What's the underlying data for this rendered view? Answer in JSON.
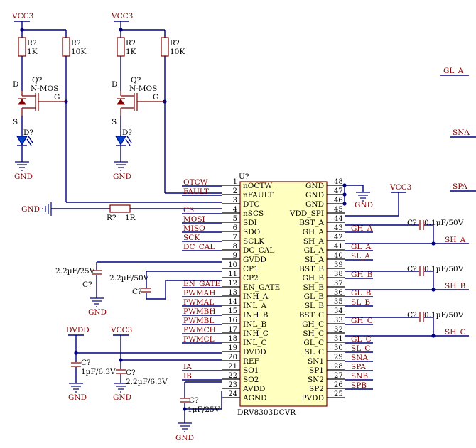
{
  "chip": {
    "designator": "U?",
    "part": "DRV8303DCVR",
    "left_pins": [
      {
        "num": "1",
        "name": "nOCTW",
        "net": "OTCW"
      },
      {
        "num": "2",
        "name": "nFAULT",
        "net": "FAULT"
      },
      {
        "num": "3",
        "name": "DTC",
        "net": ""
      },
      {
        "num": "4",
        "name": "nSCS",
        "net": "CS"
      },
      {
        "num": "5",
        "name": "SDI",
        "net": "MOSI"
      },
      {
        "num": "6",
        "name": "SDO",
        "net": "MISO"
      },
      {
        "num": "7",
        "name": "SCLK",
        "net": "SCK"
      },
      {
        "num": "8",
        "name": "DC_CAL",
        "net": "DC_CAL"
      },
      {
        "num": "9",
        "name": "GVDD",
        "net": ""
      },
      {
        "num": "10",
        "name": "CP1",
        "net": ""
      },
      {
        "num": "11",
        "name": "CP2",
        "net": ""
      },
      {
        "num": "12",
        "name": "EN_GATE",
        "net": "EN_GATE"
      },
      {
        "num": "13",
        "name": "INH_A",
        "net": "PWMAH"
      },
      {
        "num": "14",
        "name": "INL_A",
        "net": "PWMAL"
      },
      {
        "num": "15",
        "name": "INH_B",
        "net": "PWMBH"
      },
      {
        "num": "16",
        "name": "INL_B",
        "net": "PWMBL"
      },
      {
        "num": "17",
        "name": "INH_C",
        "net": "PWMCH"
      },
      {
        "num": "18",
        "name": "INL_C",
        "net": "PWMCL"
      },
      {
        "num": "19",
        "name": "DVDD",
        "net": ""
      },
      {
        "num": "20",
        "name": "REF",
        "net": ""
      },
      {
        "num": "21",
        "name": "SO1",
        "net": "IA"
      },
      {
        "num": "22",
        "name": "SO2",
        "net": "IB"
      },
      {
        "num": "23",
        "name": "AVDD",
        "net": ""
      },
      {
        "num": "24",
        "name": "AGND",
        "net": ""
      }
    ],
    "right_pins": [
      {
        "num": "48",
        "name": "GND",
        "net": ""
      },
      {
        "num": "47",
        "name": "GND",
        "net": ""
      },
      {
        "num": "46",
        "name": "GND",
        "net": ""
      },
      {
        "num": "45",
        "name": "VDD_SPI",
        "net": ""
      },
      {
        "num": "44",
        "name": "BST_A",
        "net": ""
      },
      {
        "num": "43",
        "name": "GH_A",
        "net": "GH_A"
      },
      {
        "num": "42",
        "name": "SH_A",
        "net": ""
      },
      {
        "num": "41",
        "name": "GL_A",
        "net": "GL_A"
      },
      {
        "num": "40",
        "name": "SL_A",
        "net": "SL_A"
      },
      {
        "num": "39",
        "name": "BST_B",
        "net": ""
      },
      {
        "num": "38",
        "name": "GH_B",
        "net": "GH_B"
      },
      {
        "num": "37",
        "name": "SH_B",
        "net": ""
      },
      {
        "num": "36",
        "name": "GL_B",
        "net": "GL_B"
      },
      {
        "num": "35",
        "name": "SL_B",
        "net": "SL_B"
      },
      {
        "num": "34",
        "name": "BST_C",
        "net": ""
      },
      {
        "num": "33",
        "name": "GH_C",
        "net": "GH_C"
      },
      {
        "num": "32",
        "name": "SH_C",
        "net": ""
      },
      {
        "num": "31",
        "name": "GL_C",
        "net": "GL_C"
      },
      {
        "num": "30",
        "name": "SL_C",
        "net": "SL_C"
      },
      {
        "num": "29",
        "name": "SN1",
        "net": "SNA"
      },
      {
        "num": "28",
        "name": "SP1",
        "net": "SPA"
      },
      {
        "num": "27",
        "name": "SN2",
        "net": "SNB"
      },
      {
        "num": "26",
        "name": "SP2",
        "net": "SPB"
      },
      {
        "num": "25",
        "name": "PVDD",
        "net": ""
      }
    ]
  },
  "power": {
    "vcc": "VCC3",
    "dvdd": "DVDD",
    "gnd": "GND"
  },
  "led_channels": [
    {
      "r1_des": "R?",
      "r1_val": "1K",
      "r2_des": "R?",
      "r2_val": "10K",
      "q_des": "Q?",
      "q_val": "N-MOS",
      "d_des": "D?",
      "lbl_d": "D",
      "lbl_s": "S",
      "lbl_g": "G"
    },
    {
      "r1_des": "R?",
      "r1_val": "1K",
      "r2_des": "R?",
      "r2_val": "10K",
      "q_des": "Q?",
      "q_val": "N-MOS",
      "d_des": "D?",
      "lbl_d": "D",
      "lbl_s": "S",
      "lbl_g": "G"
    }
  ],
  "dtc_resistor": {
    "des": "R?",
    "val": "1R"
  },
  "caps": {
    "gvdd": {
      "des": "C?",
      "val": "2.2µF/25V"
    },
    "cp": {
      "des": "C?",
      "val": "2.2µF/50V"
    },
    "dvdd": {
      "des": "C?",
      "val": "1µF/6.3V"
    },
    "ref": {
      "des": "C?",
      "val": "2.2µF/6.3V"
    },
    "avdd": {
      "des": "C?",
      "val": "1µF/25V"
    },
    "bst_a": {
      "des": "C?",
      "val": "0.1µF/50V"
    },
    "bst_b": {
      "des": "C?",
      "val": "0.1µF/50V"
    },
    "bst_c": {
      "des": "C?",
      "val": "0.1µF/50V"
    }
  },
  "outputs": {
    "sh_a": "SH_A",
    "sh_b": "SH_B",
    "sh_c": "SH_C"
  },
  "offpage": {
    "gl_a": "GL_A",
    "sna": "SNA",
    "spa": "SPA"
  }
}
